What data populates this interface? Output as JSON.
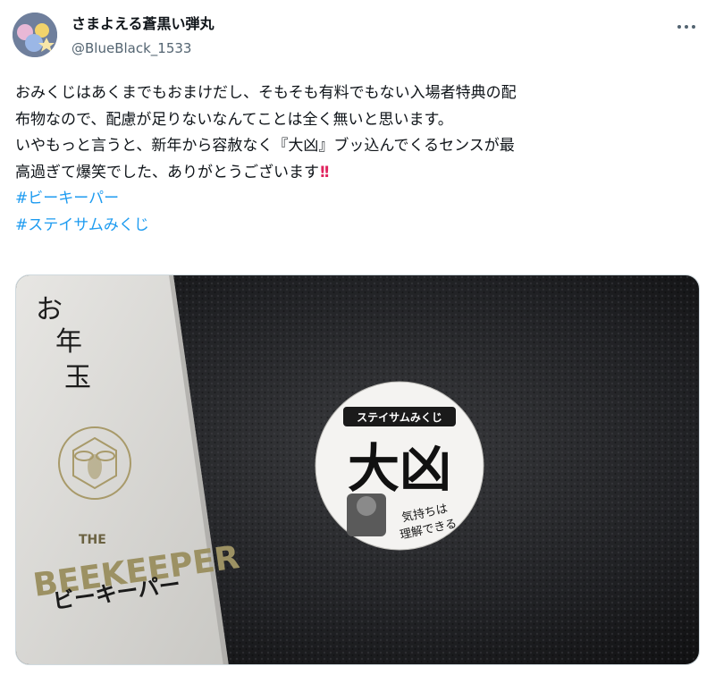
{
  "author": {
    "display_name": "さまよえる蒼黒い弾丸",
    "handle": "@BlueBlack_1533"
  },
  "tweet": {
    "lines": [
      "おみくじはあくまでもおまけだし、そもそも有料でもない入場者特典の配",
      "布物なので、配慮が足りないなんてことは全く無いと思います。",
      "いやもっと言うと、新年から容赦なく『大凶』ブッ込んでくるセンスが最",
      "高過ぎて爆笑でした、ありがとうございます"
    ],
    "emoji": "!!",
    "hashtags": [
      "#ビーキーパー",
      "#ステイサムみくじ"
    ]
  },
  "media": {
    "envelope": {
      "title_chars": [
        "お",
        "年",
        "玉"
      ],
      "the_label": "THE",
      "beekeeper_label": "BEEKEEPER",
      "kana_label": "ビーキーパー"
    },
    "omikuji": {
      "banner": "ステイサムみくじ",
      "result": "大凶",
      "message_line1": "気持ちは",
      "message_line2": "理解できる"
    }
  },
  "icons": {
    "more": "more-dots-icon",
    "avatar": "avatar-image"
  },
  "colors": {
    "link": "#1d9bf0",
    "text": "#0f1419",
    "secondary": "#536471",
    "emoji": "#e0245e"
  }
}
